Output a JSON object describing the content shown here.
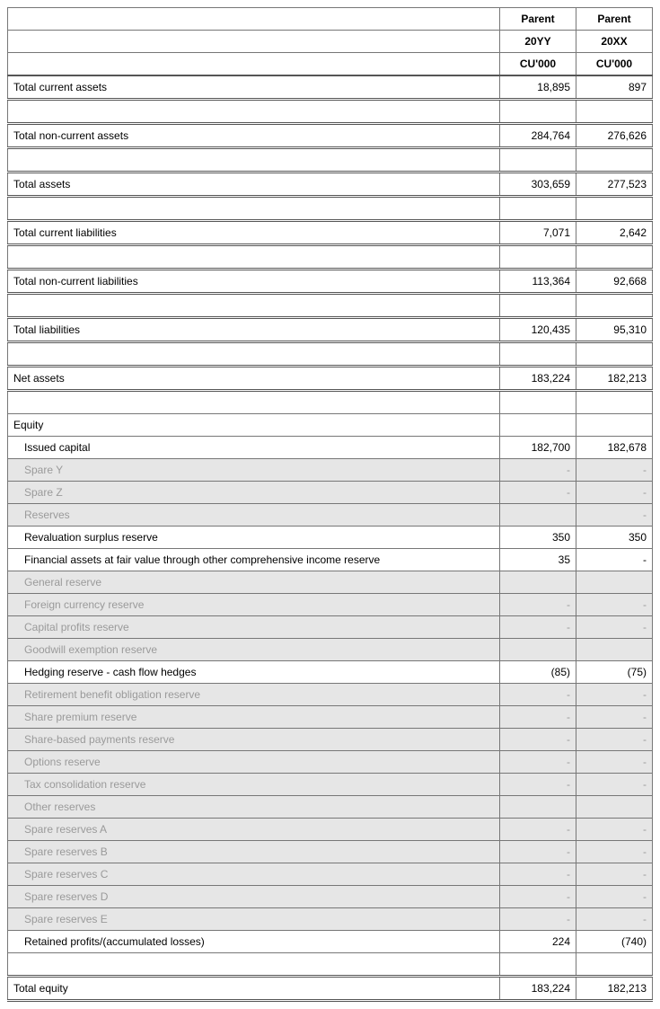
{
  "headers": {
    "col_label_1": "Parent",
    "col_label_2": "Parent",
    "year_1": "20YY",
    "year_2": "20XX",
    "unit_1": "CU'000",
    "unit_2": "CU'000"
  },
  "rows": {
    "tca": {
      "label": "Total current assets",
      "v1": "18,895",
      "v2": "897"
    },
    "tnca": {
      "label": "Total non-current assets",
      "v1": "284,764",
      "v2": "276,626"
    },
    "ta": {
      "label": "Total assets",
      "v1": "303,659",
      "v2": "277,523"
    },
    "tcl": {
      "label": "Total current liabilities",
      "v1": "7,071",
      "v2": "2,642"
    },
    "tncl": {
      "label": "Total non-current liabilities",
      "v1": "113,364",
      "v2": "92,668"
    },
    "tl": {
      "label": "Total liabilities",
      "v1": "120,435",
      "v2": "95,310"
    },
    "na": {
      "label": "Net assets",
      "v1": "183,224",
      "v2": "182,213"
    },
    "eq": {
      "label": "Equity"
    },
    "issued": {
      "label": "Issued capital",
      "v1": "182,700",
      "v2": "182,678"
    },
    "sparey": {
      "label": "Spare Y",
      "v1": "-",
      "v2": "-"
    },
    "sparez": {
      "label": "Spare Z",
      "v1": "-",
      "v2": "-"
    },
    "reserves": {
      "label": "Reserves",
      "v1": "",
      "v2": "-"
    },
    "reval": {
      "label": "Revaluation surplus reserve",
      "v1": "350",
      "v2": "350"
    },
    "finfvoci": {
      "label": "Financial assets at fair value through other comprehensive income reserve",
      "v1": "35",
      "v2": "-"
    },
    "gen": {
      "label": "General reserve",
      "v1": "",
      "v2": ""
    },
    "fx": {
      "label": "Foreign currency reserve",
      "v1": "-",
      "v2": "-"
    },
    "capprof": {
      "label": "Capital profits reserve",
      "v1": "-",
      "v2": "-"
    },
    "gwill": {
      "label": "Goodwill exemption reserve",
      "v1": "",
      "v2": ""
    },
    "hedge": {
      "label": "Hedging reserve - cash flow hedges",
      "v1": "(85)",
      "v2": "(75)"
    },
    "retire": {
      "label": "Retirement benefit obligation reserve",
      "v1": "-",
      "v2": "-"
    },
    "premium": {
      "label": "Share premium reserve",
      "v1": "-",
      "v2": "-"
    },
    "sbp": {
      "label": "Share-based payments reserve",
      "v1": "-",
      "v2": "-"
    },
    "options": {
      "label": "Options reserve",
      "v1": "-",
      "v2": "-"
    },
    "taxcons": {
      "label": "Tax consolidation reserve",
      "v1": "-",
      "v2": "-"
    },
    "other": {
      "label": "Other reserves",
      "v1": "",
      "v2": ""
    },
    "sra": {
      "label": "Spare reserves A",
      "v1": "-",
      "v2": "-"
    },
    "srb": {
      "label": "Spare reserves B",
      "v1": "-",
      "v2": "-"
    },
    "src": {
      "label": "Spare reserves C",
      "v1": "-",
      "v2": "-"
    },
    "srd": {
      "label": "Spare reserves D",
      "v1": "-",
      "v2": "-"
    },
    "sre": {
      "label": "Spare reserves E",
      "v1": "-",
      "v2": "-"
    },
    "retained": {
      "label": "Retained profits/(accumulated losses)",
      "v1": "224",
      "v2": "(740)"
    },
    "toteq": {
      "label": "Total equity",
      "v1": "183,224",
      "v2": "182,213"
    }
  }
}
